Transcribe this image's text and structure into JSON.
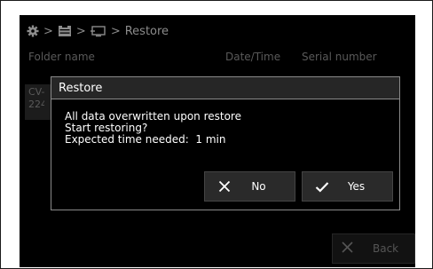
{
  "breadcrumb": {
    "items": [
      "settings-icon",
      "device-icon",
      "storage-icon"
    ],
    "separator": ">",
    "current": "Restore"
  },
  "table": {
    "columns": [
      "Folder name",
      "Date/Time",
      "Serial number"
    ],
    "row_partial_text": [
      "CV-",
      "224"
    ]
  },
  "footer": {
    "back_label": "Back"
  },
  "dialog": {
    "title": "Restore",
    "message_lines": [
      "All data overwritten upon restore",
      "Start restoring?",
      "Expected time needed:  1 min"
    ],
    "no_label": "No",
    "yes_label": "Yes"
  }
}
